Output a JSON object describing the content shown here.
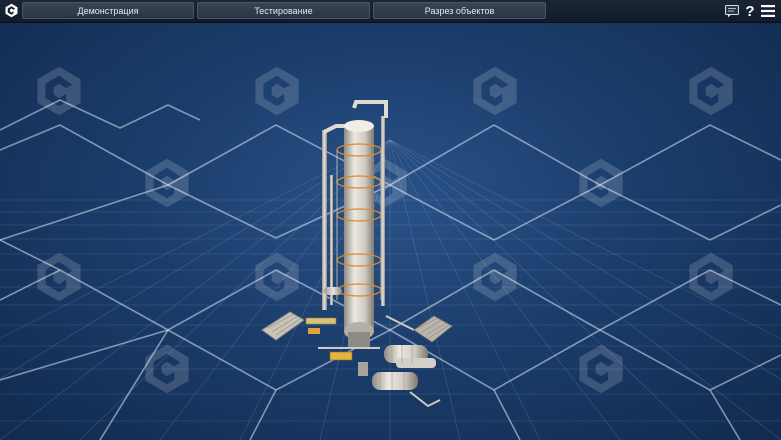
{
  "toolbar": {
    "tabs": [
      {
        "label": "Демонстрация"
      },
      {
        "label": "Тестирование"
      },
      {
        "label": "Разрез объектов"
      }
    ],
    "help_label": "?",
    "icons": [
      "app-logo-icon",
      "chat-icon",
      "help-icon",
      "hamburger-menu-icon"
    ]
  },
  "scene": {
    "background_color": "#1b3d6c",
    "grid_color": "#9fb8dc",
    "column_color": "#d9d6cf"
  }
}
